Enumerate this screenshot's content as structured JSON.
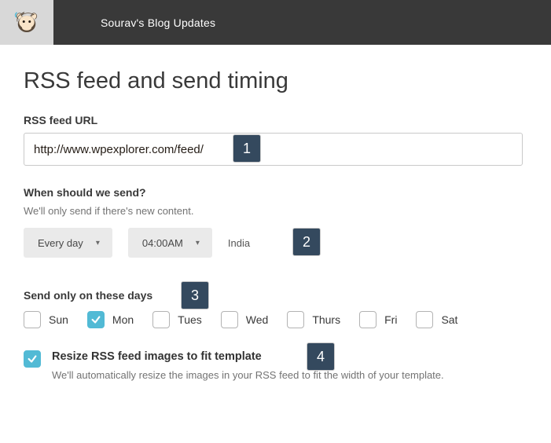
{
  "topbar": {
    "breadcrumb": "Sourav's Blog Updates"
  },
  "page_title": "RSS feed and send timing",
  "rss": {
    "label": "RSS feed URL",
    "value": "http://www.wpexplorer.com/feed/"
  },
  "schedule": {
    "label": "When should we send?",
    "hint": "We'll only send if there's new content.",
    "frequency": "Every day",
    "time": "04:00AM",
    "timezone": "India"
  },
  "days": {
    "label": "Send only on these days",
    "items": [
      {
        "label": "Sun",
        "checked": false
      },
      {
        "label": "Mon",
        "checked": true
      },
      {
        "label": "Tues",
        "checked": false
      },
      {
        "label": "Wed",
        "checked": false
      },
      {
        "label": "Thurs",
        "checked": false
      },
      {
        "label": "Fri",
        "checked": false
      },
      {
        "label": "Sat",
        "checked": false
      }
    ]
  },
  "resize": {
    "checked": true,
    "title": "Resize RSS feed images to fit template",
    "desc": "We'll automatically resize the images in your RSS feed to fit the width of your template."
  },
  "annotations": [
    "1",
    "2",
    "3",
    "4"
  ]
}
